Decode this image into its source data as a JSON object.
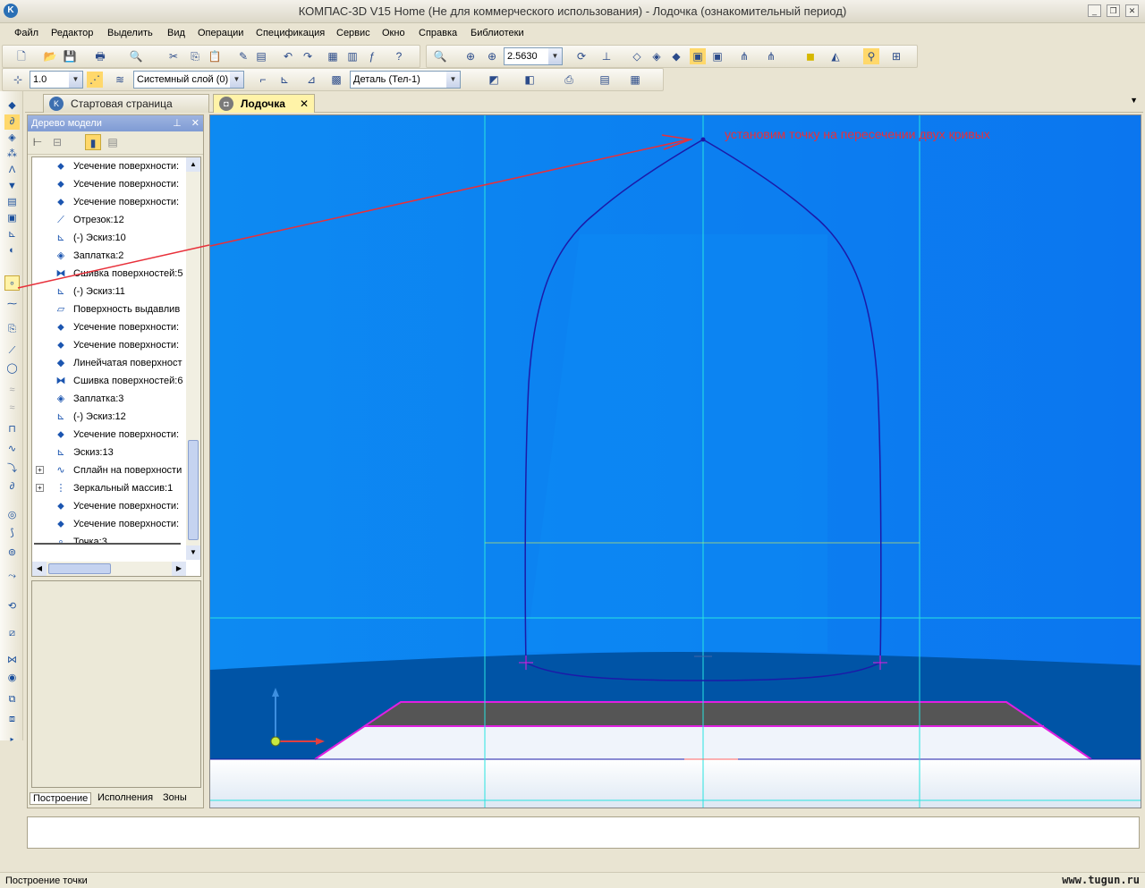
{
  "window": {
    "title": "КОМПАС-3D V15 Home (Не для коммерческого использования) - Лодочка (ознакомительный период)"
  },
  "menu": [
    "Файл",
    "Редактор",
    "Выделить",
    "Вид",
    "Операции",
    "Спецификация",
    "Сервис",
    "Окно",
    "Справка",
    "Библиотеки"
  ],
  "toolbar": {
    "zoom_value": "2.5630",
    "step_value": "1.0",
    "layer_value": "Системный слой (0)",
    "part_value": "Деталь (Тел-1)"
  },
  "tabs": {
    "start_page": "Стартовая страница",
    "document": "Лодочка",
    "close": "✕"
  },
  "tree": {
    "title": "Дерево модели",
    "items": [
      {
        "label": "Усечение поверхности:",
        "icon": "trim-surface-icon"
      },
      {
        "label": "Усечение поверхности:",
        "icon": "trim-surface-icon"
      },
      {
        "label": "Усечение поверхности:",
        "icon": "trim-surface-icon"
      },
      {
        "label": "Отрезок:12",
        "icon": "segment-icon"
      },
      {
        "label": "(-) Эскиз:10",
        "icon": "sketch-icon"
      },
      {
        "label": "Заплатка:2",
        "icon": "patch-icon"
      },
      {
        "label": "Сшивка поверхностей:5",
        "icon": "stitch-icon"
      },
      {
        "label": "(-) Эскиз:11",
        "icon": "sketch-icon"
      },
      {
        "label": "Поверхность выдавлив",
        "icon": "extrude-surface-icon"
      },
      {
        "label": "Усечение поверхности:",
        "icon": "trim-surface-icon"
      },
      {
        "label": "Усечение поверхности:",
        "icon": "trim-surface-icon"
      },
      {
        "label": "Линейчатая поверхност",
        "icon": "ruled-surface-icon"
      },
      {
        "label": "Сшивка поверхностей:6",
        "icon": "stitch-icon"
      },
      {
        "label": "Заплатка:3",
        "icon": "patch-icon"
      },
      {
        "label": "(-) Эскиз:12",
        "icon": "sketch-icon"
      },
      {
        "label": "Усечение поверхности:",
        "icon": "trim-surface-icon"
      },
      {
        "label": "Эскиз:13",
        "icon": "sketch-icon"
      },
      {
        "label": "Сплайн на поверхности",
        "icon": "spline-icon"
      },
      {
        "label": "Зеркальный массив:1",
        "icon": "mirror-icon"
      },
      {
        "label": "Усечение поверхности:",
        "icon": "trim-surface-icon"
      },
      {
        "label": "Усечение поверхности:",
        "icon": "trim-surface-icon"
      },
      {
        "label": "Точка:3",
        "icon": "point-icon"
      }
    ],
    "bottom_tabs": [
      "Построение",
      "Исполнения",
      "Зоны"
    ]
  },
  "annotation": "установим точку на пересечении двух кривых",
  "status": {
    "text": "Построение точки",
    "watermark": "www.tugun.ru"
  },
  "colors": {
    "viewport_bg": "#0a7cf5",
    "annotation": "#e8303a",
    "curve": "#1c1aa8",
    "guide": "#29e3e0",
    "base_edge": "#e020e0"
  }
}
